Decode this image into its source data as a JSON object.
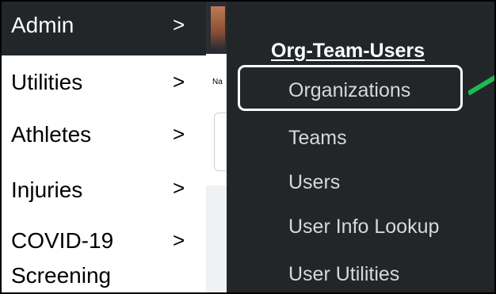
{
  "left_menu": {
    "items": [
      {
        "label": "Admin",
        "chevron": ">"
      },
      {
        "label": "Utilities",
        "chevron": ">"
      },
      {
        "label": "Athletes",
        "chevron": ">"
      },
      {
        "label": "Injuries",
        "chevron": ">"
      },
      {
        "label": "COVID-19",
        "label_line2": "Screening",
        "chevron": ">"
      }
    ]
  },
  "page_fragment": {
    "label": "Na"
  },
  "submenu": {
    "heading": "Org-Team-Users",
    "items": [
      {
        "label": "Organizations"
      },
      {
        "label": "Teams"
      },
      {
        "label": "Users"
      },
      {
        "label": "User Info Lookup"
      },
      {
        "label": "User Utilities"
      }
    ]
  },
  "colors": {
    "menu_dark": "#222629",
    "highlight_border": "#ffffff",
    "arrow": "#1db954"
  }
}
